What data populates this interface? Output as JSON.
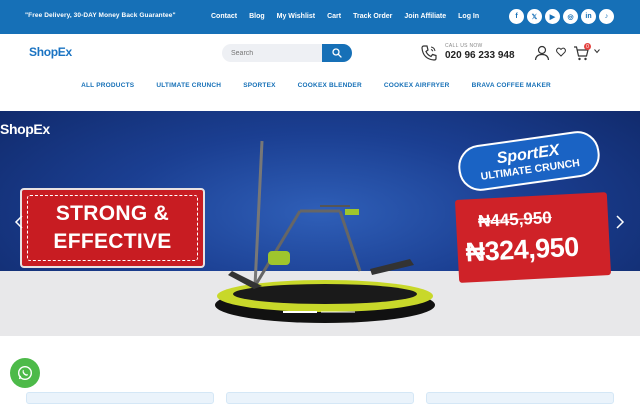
{
  "topbar": {
    "promo": "\"Free Delivery, 30-DAY Money Back Guarantee\"",
    "links": [
      "Contact",
      "Blog",
      "My Wishlist",
      "Cart",
      "Track Order",
      "Join Affiliate",
      "Log In"
    ],
    "socials": [
      {
        "icon": "facebook-icon",
        "glyph": "f"
      },
      {
        "icon": "x-icon",
        "glyph": "𝕏"
      },
      {
        "icon": "youtube-icon",
        "glyph": "▶"
      },
      {
        "icon": "instagram-icon",
        "glyph": "◎"
      },
      {
        "icon": "linkedin-icon",
        "glyph": "in"
      },
      {
        "icon": "tiktok-icon",
        "glyph": "♪"
      }
    ]
  },
  "header": {
    "logo": "ShopEx",
    "search_placeholder": "Search",
    "call_label": "CALL US NOW",
    "call_number": "020 96 233 948",
    "cart_count": "0"
  },
  "nav": [
    "ALL PRODUCTS",
    "ULTIMATE CRUNCH",
    "SPORTEX",
    "COOKEX BLENDER",
    "COOKEX AIRFRYER",
    "BRAVA COFFEE MAKER"
  ],
  "hero": {
    "logo": "ShopEx",
    "headline_line1": "STRONG &",
    "headline_line2": "EFFECTIVE",
    "badge_line1": "SportEX",
    "badge_line2": "ULTIMATE CRUNCH",
    "old_price": "₦445,950",
    "new_price": "₦324,950"
  },
  "colors": {
    "brand_blue": "#1670b7",
    "hero_red": "#c81c22",
    "whatsapp_green": "#4dba49"
  }
}
